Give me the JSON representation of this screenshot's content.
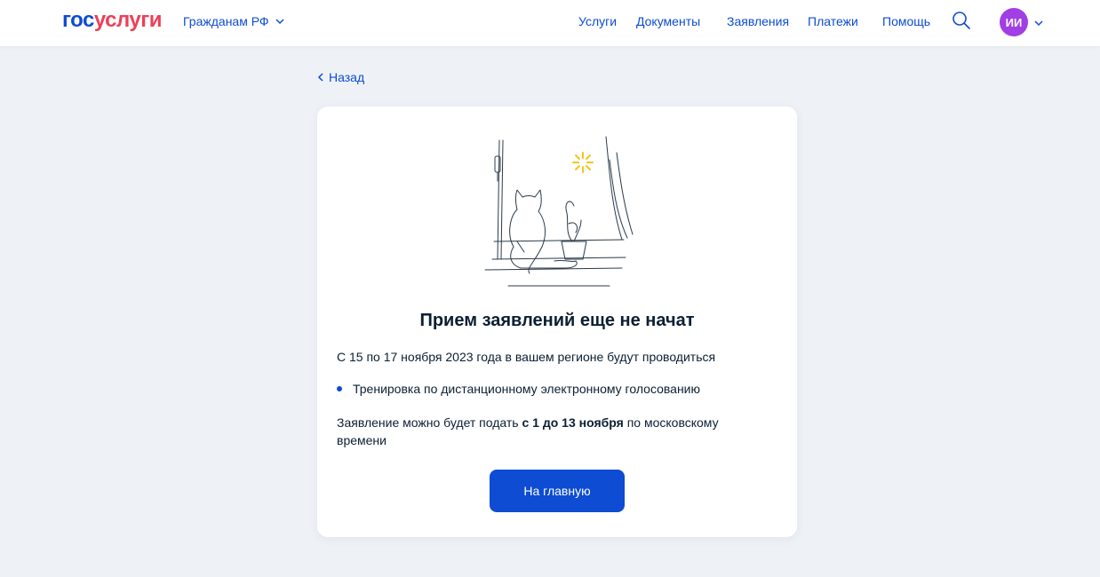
{
  "header": {
    "logo_part1": "гос",
    "logo_part2": "услуги",
    "audience_label": "Гражданам РФ",
    "nav": [
      "Услуги",
      "Документы",
      "Заявления",
      "Платежи",
      "Помощь"
    ],
    "avatar_initials": "ИИ",
    "icons": [
      "chevron-down-icon",
      "search-icon"
    ]
  },
  "back_label": "Назад",
  "card": {
    "title": "Прием заявлений еще не начат",
    "intro": "С 15 по 17 ноября 2023 года в вашем регионе будут проводиться",
    "bullet": "Тренировка по дистанционному электронному голосованию",
    "deadline_prefix": "Заявление можно будет подать ",
    "deadline_bold": "с 1 до 13 ноября",
    "deadline_suffix": " по московскому времени",
    "button_label": "На главную"
  },
  "colors": {
    "brand_blue": "#0d4cd3",
    "brand_red": "#ee3f58",
    "avatar": "#a13ee4",
    "background": "#eef2f7",
    "sun": "#f5c518"
  }
}
